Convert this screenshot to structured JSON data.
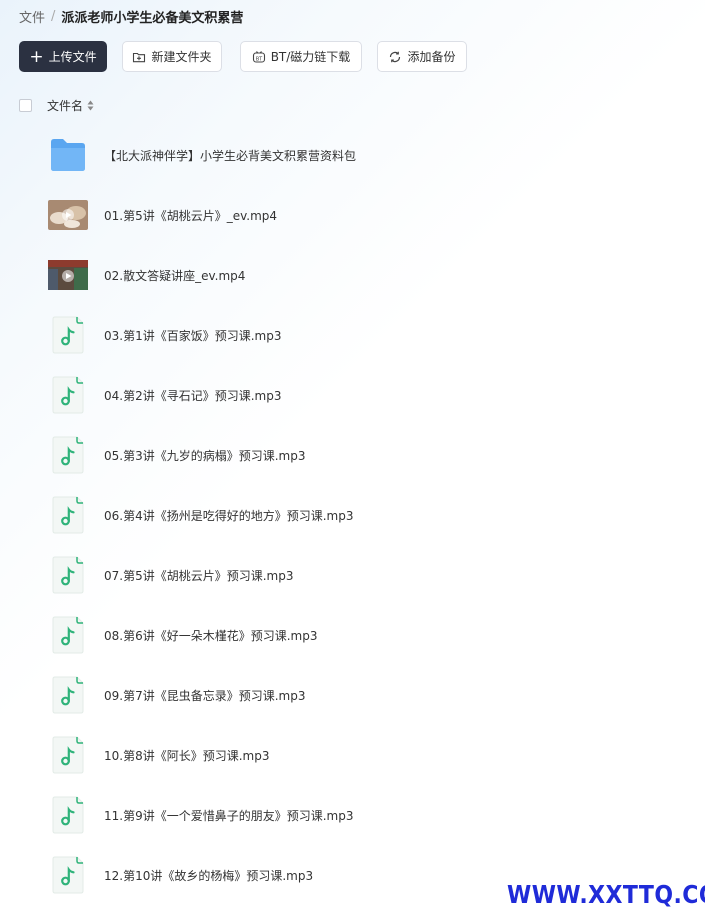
{
  "breadcrumb": {
    "root": "文件",
    "separator": "/",
    "current": "派派老师小学生必备美文积累营"
  },
  "toolbar": {
    "upload": "上传文件",
    "new_folder": "新建文件夹",
    "bt_download": "BT/磁力链下载",
    "add_backup": "添加备份"
  },
  "table": {
    "name_header": "文件名"
  },
  "files": [
    {
      "name": "【北大派神伴学】小学生必背美文积累营资料包",
      "type": "folder"
    },
    {
      "name": "01.第5讲《胡桃云片》_ev.mp4",
      "type": "video"
    },
    {
      "name": "02.散文答疑讲座_ev.mp4",
      "type": "video"
    },
    {
      "name": "03.第1讲《百家饭》预习课.mp3",
      "type": "audio"
    },
    {
      "name": "04.第2讲《寻石记》预习课.mp3",
      "type": "audio"
    },
    {
      "name": "05.第3讲《九岁的病榻》预习课.mp3",
      "type": "audio"
    },
    {
      "name": "06.第4讲《扬州是吃得好的地方》预习课.mp3",
      "type": "audio"
    },
    {
      "name": "07.第5讲《胡桃云片》预习课.mp3",
      "type": "audio"
    },
    {
      "name": "08.第6讲《好一朵木槿花》预习课.mp3",
      "type": "audio"
    },
    {
      "name": "09.第7讲《昆虫备忘录》预习课.mp3",
      "type": "audio"
    },
    {
      "name": "10.第8讲《阿长》预习课.mp3",
      "type": "audio"
    },
    {
      "name": "11.第9讲《一个爱惜鼻子的朋友》预习课.mp3",
      "type": "audio"
    },
    {
      "name": "12.第10讲《故乡的杨梅》预习课.mp3",
      "type": "audio"
    }
  ],
  "watermark": "WWW.XXTTQ.COM",
  "colors": {
    "primary_button": "#2b3141",
    "folder": "#5aa6f0",
    "audio_icon": "#2fb37a",
    "watermark": "#1f2bd8"
  }
}
